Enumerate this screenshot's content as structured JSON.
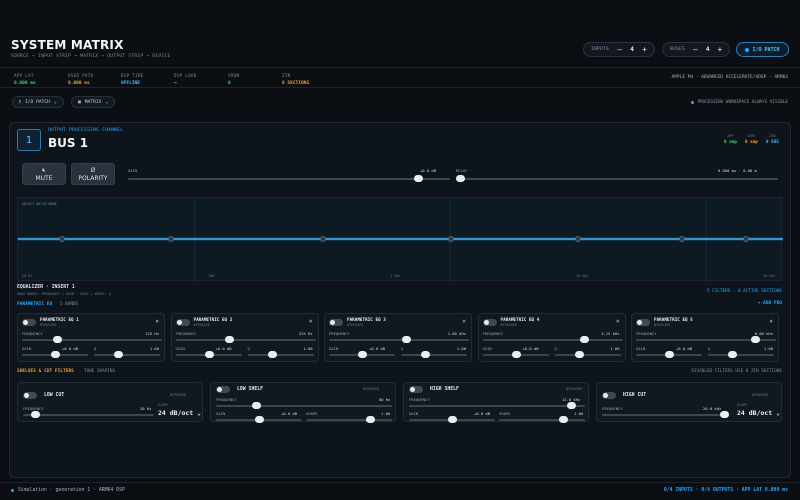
{
  "header": {
    "title": "SYSTEM MATRIX",
    "subtitle": "SOURCE → INPUT STRIP → MATRIX → OUTPUT STRIP → DEVICE",
    "inputs_label": "INPUTS",
    "inputs_value": "4",
    "buses_label": "BUSES",
    "buses_value": "4",
    "minus": "—",
    "plus": "+",
    "io_patch": "I/O PATCH"
  },
  "stats": [
    {
      "k": "APP LAT",
      "v": "0.000 ms",
      "color": "#3fd07a"
    },
    {
      "k": "USER PATH",
      "v": "0.000 ms",
      "color": "#e8a23a"
    },
    {
      "k": "DSP TIME",
      "v": "OFFLINE",
      "color": "#4fb6f5"
    },
    {
      "k": "DSP LOAD",
      "v": "—",
      "color": "#c8d3de"
    },
    {
      "k": "XRUN",
      "v": "0",
      "color": "#3fd07a"
    },
    {
      "k": "ZIN",
      "v": "0 SECTIONS",
      "color": "#e8a23a"
    }
  ],
  "device": "APPLE M4 · ADVANCED ACCELERATE/VDSP · ARM64",
  "toolbar": {
    "io_patch": "I/O PATCH",
    "matrix": "MATRIX",
    "note": "PROCESSING WORKSPACE ALWAYS VISIBLE"
  },
  "channel": {
    "number": "1",
    "kicker": "OUTPUT PROCESSING CHANNEL",
    "name": "BUS 1",
    "lat": [
      {
        "k": "APP",
        "v": "0 smp",
        "color": "#3fd07a"
      },
      {
        "k": "USER",
        "v": "0 smp",
        "color": "#e8a23a"
      },
      {
        "k": "ZIN",
        "v": "0 SOS",
        "color": "#4fb6f5"
      }
    ],
    "mute": "MUTE",
    "polarity": "POLARITY",
    "gain_label": "GAIN",
    "gain_value": "+0.0 dB",
    "gain_level": 0.9,
    "delay_label": "DELAY",
    "delay_value": "0.000 ms · 0.00 m",
    "delay_level": 0.0
  },
  "eq": {
    "hint": "SELECT AN EQ NODE",
    "freq_ticks": [
      "20 Hz",
      "100",
      "1 kHz",
      "10 kHz",
      "20 kHz"
    ],
    "title": "EQUALIZER · INSERT 1",
    "help": "DRAG NODES: FREQUENCY / GAIN · HOLD + WHEEL: Q",
    "status": "5 FILTERS · 0 ACTIVE SECTIONS",
    "param_tab": "PARAMETRIC EQ",
    "bands_tab": "5 BANDS",
    "add_peq": "+ ADD PEQ"
  },
  "peq": [
    {
      "name": "PARAMETRIC EQ 1",
      "state": "BYPASSED",
      "freq": "125 Hz",
      "freq_level": 0.25,
      "gain": "+0.0 dB",
      "q": "1.00"
    },
    {
      "name": "PARAMETRIC EQ 2",
      "state": "BYPASSED",
      "freq": "315 Hz",
      "freq_level": 0.38,
      "gain": "+0.0 dB",
      "q": "1.00"
    },
    {
      "name": "PARAMETRIC EQ 3",
      "state": "BYPASSED",
      "freq": "1.00 kHz",
      "freq_level": 0.55,
      "gain": "+0.0 dB",
      "q": "1.00"
    },
    {
      "name": "PARAMETRIC EQ 4",
      "state": "BYPASSED",
      "freq": "3.15 kHz",
      "freq_level": 0.72,
      "gain": "+0.0 dB",
      "q": "1.00"
    },
    {
      "name": "PARAMETRIC EQ 5",
      "state": "BYPASSED",
      "freq": "8.00 kHz",
      "freq_level": 0.85,
      "gain": "+0.0 dB",
      "q": "1.00"
    }
  ],
  "shelves": {
    "tab": "SHELVES & CUT FILTERS",
    "tone": "TONE SHAPING",
    "note": "DISABLED FILTERS USE 0 ZIN SECTIONS",
    "low_cut": {
      "name": "LOW CUT",
      "state": "BYPASSED",
      "freq": "20 Hz",
      "slope_label": "SLOPE",
      "slope": "24 dB/oct"
    },
    "low_shelf": {
      "name": "LOW SHELF",
      "state": "BYPASSED",
      "freq": "80 Hz",
      "gain": "+0.0 dB",
      "shape": "1.00"
    },
    "high_shelf": {
      "name": "HIGH SHELF",
      "state": "BYPASSED",
      "freq": "12.0 kHz",
      "gain": "+0.0 dB",
      "shape": "1.00"
    },
    "high_cut": {
      "name": "HIGH CUT",
      "state": "BYPASSED",
      "freq": "20.0 kHz",
      "slope_label": "SLOPE",
      "slope": "24 dB/oct"
    }
  },
  "labels": {
    "frequency": "FREQUENCY",
    "gain": "GAIN",
    "q": "Q",
    "shape": "SHAPE"
  },
  "footer": {
    "left": "Simulation · generation 1 · ARM64 DSP",
    "right": "0/4 INPUTS · 0/4 OUTPUTS · APP LAT 0.000 ms"
  },
  "colors": {
    "accent": "#29a8ff",
    "green": "#3fd07a",
    "amber": "#e8a23a"
  }
}
